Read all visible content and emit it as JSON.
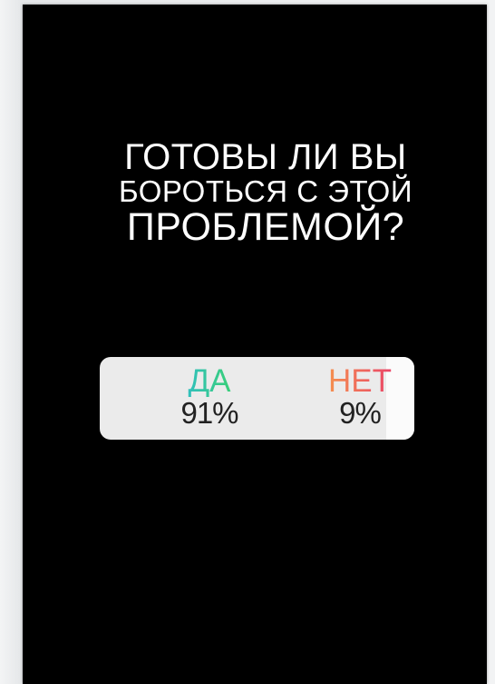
{
  "question": {
    "line1": "ГОТОВЫ ЛИ ВЫ",
    "line2": "БОРОТЬСЯ С ЭТОЙ",
    "line3": "ПРОБЛЕМОЙ?"
  },
  "poll": {
    "options": [
      {
        "label": "ДА",
        "percent_text": "91%",
        "percent": 91,
        "gradient": [
          "#2bb6e8",
          "#3fd94c"
        ]
      },
      {
        "label": "НЕТ",
        "percent_text": "9%",
        "percent": 9,
        "gradient": [
          "#f7a548",
          "#e8306f"
        ]
      }
    ]
  },
  "colors": {
    "background": "#000000",
    "text": "#ffffff",
    "poll_bg": "#ebebeb"
  }
}
